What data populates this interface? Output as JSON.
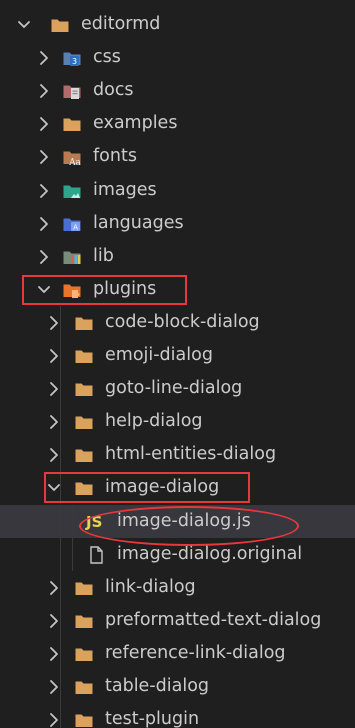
{
  "explorer": {
    "items": [
      {
        "label": "editormd",
        "depth": 0,
        "kind": "folder",
        "expanded": true,
        "icon": "folder-icon"
      },
      {
        "label": "css",
        "depth": 1,
        "kind": "folder",
        "expanded": false,
        "icon": "css-folder-icon"
      },
      {
        "label": "docs",
        "depth": 1,
        "kind": "folder",
        "expanded": false,
        "icon": "docs-folder-icon"
      },
      {
        "label": "examples",
        "depth": 1,
        "kind": "folder",
        "expanded": false,
        "icon": "folder-icon"
      },
      {
        "label": "fonts",
        "depth": 1,
        "kind": "folder",
        "expanded": false,
        "icon": "fonts-folder-icon"
      },
      {
        "label": "images",
        "depth": 1,
        "kind": "folder",
        "expanded": false,
        "icon": "images-folder-icon"
      },
      {
        "label": "languages",
        "depth": 1,
        "kind": "folder",
        "expanded": false,
        "icon": "languages-folder-icon"
      },
      {
        "label": "lib",
        "depth": 1,
        "kind": "folder",
        "expanded": false,
        "icon": "lib-folder-icon"
      },
      {
        "label": "plugins",
        "depth": 1,
        "kind": "folder",
        "expanded": true,
        "icon": "plugins-folder-icon"
      },
      {
        "label": "code-block-dialog",
        "depth": 2,
        "kind": "folder",
        "expanded": false,
        "icon": "folder-icon"
      },
      {
        "label": "emoji-dialog",
        "depth": 2,
        "kind": "folder",
        "expanded": false,
        "icon": "folder-icon"
      },
      {
        "label": "goto-line-dialog",
        "depth": 2,
        "kind": "folder",
        "expanded": false,
        "icon": "folder-icon"
      },
      {
        "label": "help-dialog",
        "depth": 2,
        "kind": "folder",
        "expanded": false,
        "icon": "folder-icon"
      },
      {
        "label": "html-entities-dialog",
        "depth": 2,
        "kind": "folder",
        "expanded": false,
        "icon": "folder-icon"
      },
      {
        "label": "image-dialog",
        "depth": 2,
        "kind": "folder",
        "expanded": true,
        "icon": "folder-icon"
      },
      {
        "label": "image-dialog.js",
        "depth": 3,
        "kind": "file",
        "icon": "js-file-icon",
        "icon_text": "JS",
        "selected": true
      },
      {
        "label": "image-dialog.original",
        "depth": 3,
        "kind": "file",
        "icon": "file-icon"
      },
      {
        "label": "link-dialog",
        "depth": 2,
        "kind": "folder",
        "expanded": false,
        "icon": "folder-icon"
      },
      {
        "label": "preformatted-text-dialog",
        "depth": 2,
        "kind": "folder",
        "expanded": false,
        "icon": "folder-icon"
      },
      {
        "label": "reference-link-dialog",
        "depth": 2,
        "kind": "folder",
        "expanded": false,
        "icon": "folder-icon"
      },
      {
        "label": "table-dialog",
        "depth": 2,
        "kind": "folder",
        "expanded": false,
        "icon": "folder-icon"
      },
      {
        "label": "test-plugin",
        "depth": 2,
        "kind": "folder",
        "expanded": false,
        "icon": "folder-icon"
      }
    ]
  },
  "colors": {
    "background": "#1f1f1f",
    "text": "#cccccc",
    "selected_row": "#37373d",
    "folder": "#d9a25c",
    "annotation": "#e5393e",
    "js": "#e8d44d"
  }
}
